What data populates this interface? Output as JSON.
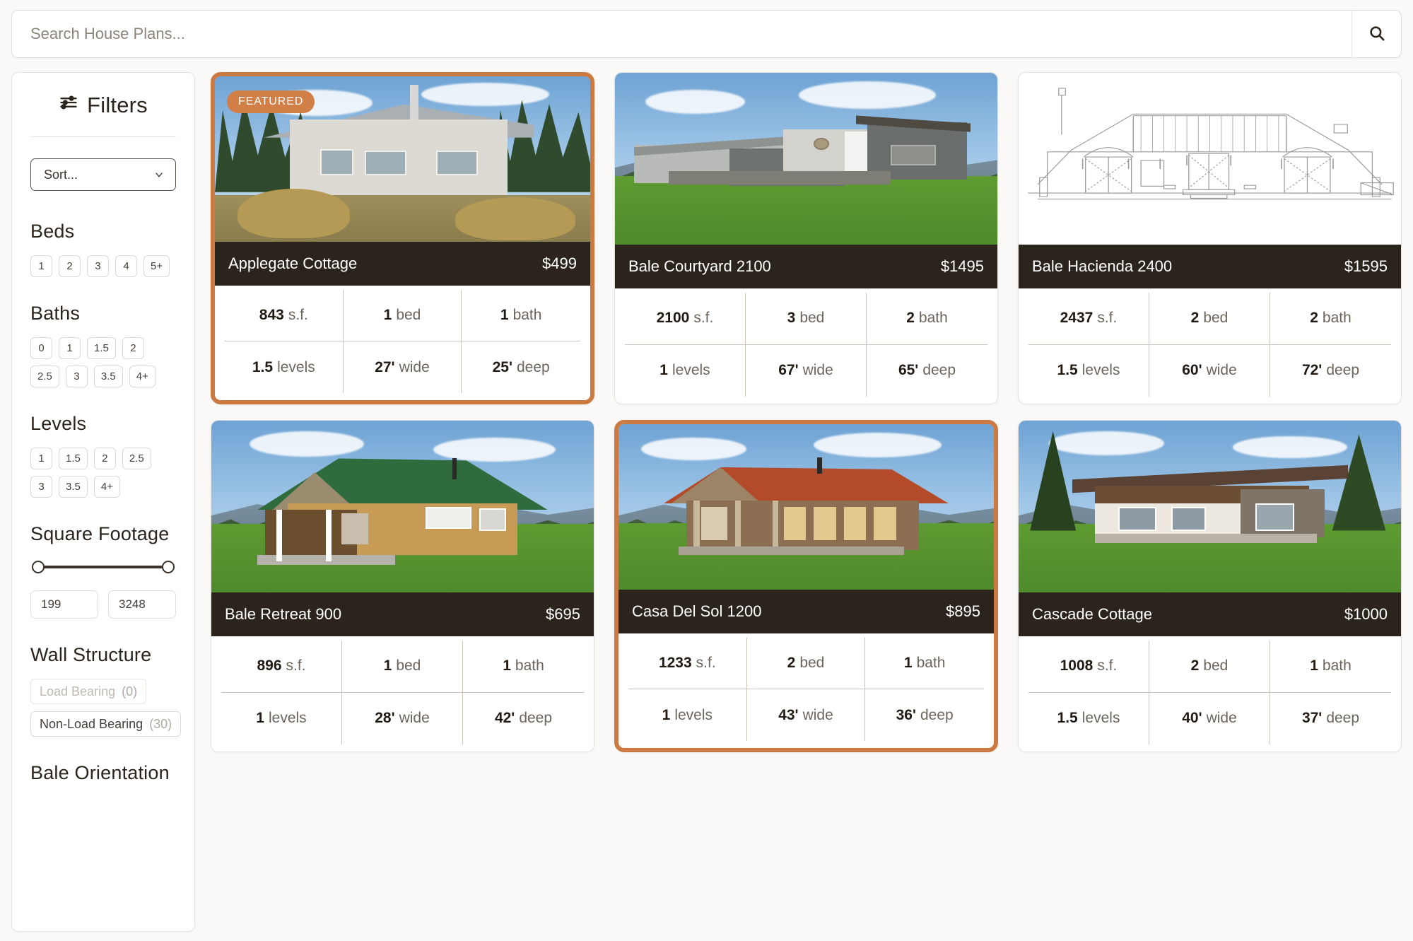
{
  "search": {
    "placeholder": "Search House Plans...",
    "value": "",
    "icon": "search-icon"
  },
  "sidebar": {
    "title": "Filters",
    "icon": "sliders-icon",
    "sort": {
      "label": "Sort...",
      "options": [
        "Sort..."
      ]
    },
    "groups": [
      {
        "name": "Beds",
        "title": "Beds",
        "chips": [
          "1",
          "2",
          "3",
          "4",
          "5+"
        ]
      },
      {
        "name": "Baths",
        "title": "Baths",
        "chips": [
          "0",
          "1",
          "1.5",
          "2",
          "2.5",
          "3",
          "3.5",
          "4+"
        ]
      },
      {
        "name": "Levels",
        "title": "Levels",
        "chips": [
          "1",
          "1.5",
          "2",
          "2.5",
          "3",
          "3.5",
          "4+"
        ]
      }
    ],
    "square_footage": {
      "title": "Square Footage",
      "min": "199",
      "max": "3248"
    },
    "wall_structure": {
      "title": "Wall Structure",
      "options": [
        {
          "label": "Load Bearing",
          "count": "(0)",
          "disabled": true
        },
        {
          "label": "Non-Load Bearing",
          "count": "(30)",
          "disabled": false
        }
      ]
    },
    "bale_orientation": {
      "title": "Bale Orientation"
    }
  },
  "colors": {
    "accent_orange": "#CC7A42",
    "badge_orange": "#D17F47",
    "card_header_dark": "#2B241C",
    "page_background": "#FAF9F7"
  },
  "results": [
    {
      "name": "Applegate Cottage",
      "price": "$499",
      "featured": true,
      "badge": "FEATURED",
      "highlight": true,
      "image": "photo-white-stucco-cottage",
      "specs": [
        {
          "value": "843",
          "unit": "s.f."
        },
        {
          "value": "1",
          "unit": "bed"
        },
        {
          "value": "1",
          "unit": "bath"
        },
        {
          "value": "1.5",
          "unit": "levels"
        },
        {
          "value": "27'",
          "unit": "wide"
        },
        {
          "value": "25'",
          "unit": "deep"
        }
      ]
    },
    {
      "name": "Bale Courtyard 2100",
      "price": "$1495",
      "featured": false,
      "badge": "",
      "highlight": false,
      "image": "render-grey-modern-house",
      "specs": [
        {
          "value": "2100",
          "unit": "s.f."
        },
        {
          "value": "3",
          "unit": "bed"
        },
        {
          "value": "2",
          "unit": "bath"
        },
        {
          "value": "1",
          "unit": "levels"
        },
        {
          "value": "67'",
          "unit": "wide"
        },
        {
          "value": "65'",
          "unit": "deep"
        }
      ]
    },
    {
      "name": "Bale Hacienda 2400",
      "price": "$1595",
      "featured": false,
      "badge": "",
      "highlight": false,
      "image": "architectural-elevation-drawing",
      "specs": [
        {
          "value": "2437",
          "unit": "s.f."
        },
        {
          "value": "2",
          "unit": "bed"
        },
        {
          "value": "2",
          "unit": "bath"
        },
        {
          "value": "1.5",
          "unit": "levels"
        },
        {
          "value": "60'",
          "unit": "wide"
        },
        {
          "value": "72'",
          "unit": "deep"
        }
      ]
    },
    {
      "name": "Bale Retreat 900",
      "price": "$695",
      "featured": false,
      "badge": "",
      "highlight": false,
      "image": "render-green-roof-tan-house",
      "specs": [
        {
          "value": "896",
          "unit": "s.f."
        },
        {
          "value": "1",
          "unit": "bed"
        },
        {
          "value": "1",
          "unit": "bath"
        },
        {
          "value": "1",
          "unit": "levels"
        },
        {
          "value": "28'",
          "unit": "wide"
        },
        {
          "value": "42'",
          "unit": "deep"
        }
      ]
    },
    {
      "name": "Casa Del Sol 1200",
      "price": "$895",
      "featured": false,
      "badge": "",
      "highlight": true,
      "image": "render-red-roof-adobe-house",
      "specs": [
        {
          "value": "1233",
          "unit": "s.f."
        },
        {
          "value": "2",
          "unit": "bed"
        },
        {
          "value": "1",
          "unit": "bath"
        },
        {
          "value": "1",
          "unit": "levels"
        },
        {
          "value": "43'",
          "unit": "wide"
        },
        {
          "value": "36'",
          "unit": "deep"
        }
      ]
    },
    {
      "name": "Cascade Cottage",
      "price": "$1000",
      "featured": false,
      "badge": "",
      "highlight": false,
      "image": "render-modern-flat-roof-house",
      "specs": [
        {
          "value": "1008",
          "unit": "s.f."
        },
        {
          "value": "2",
          "unit": "bed"
        },
        {
          "value": "1",
          "unit": "bath"
        },
        {
          "value": "1.5",
          "unit": "levels"
        },
        {
          "value": "40'",
          "unit": "wide"
        },
        {
          "value": "37'",
          "unit": "deep"
        }
      ]
    }
  ]
}
